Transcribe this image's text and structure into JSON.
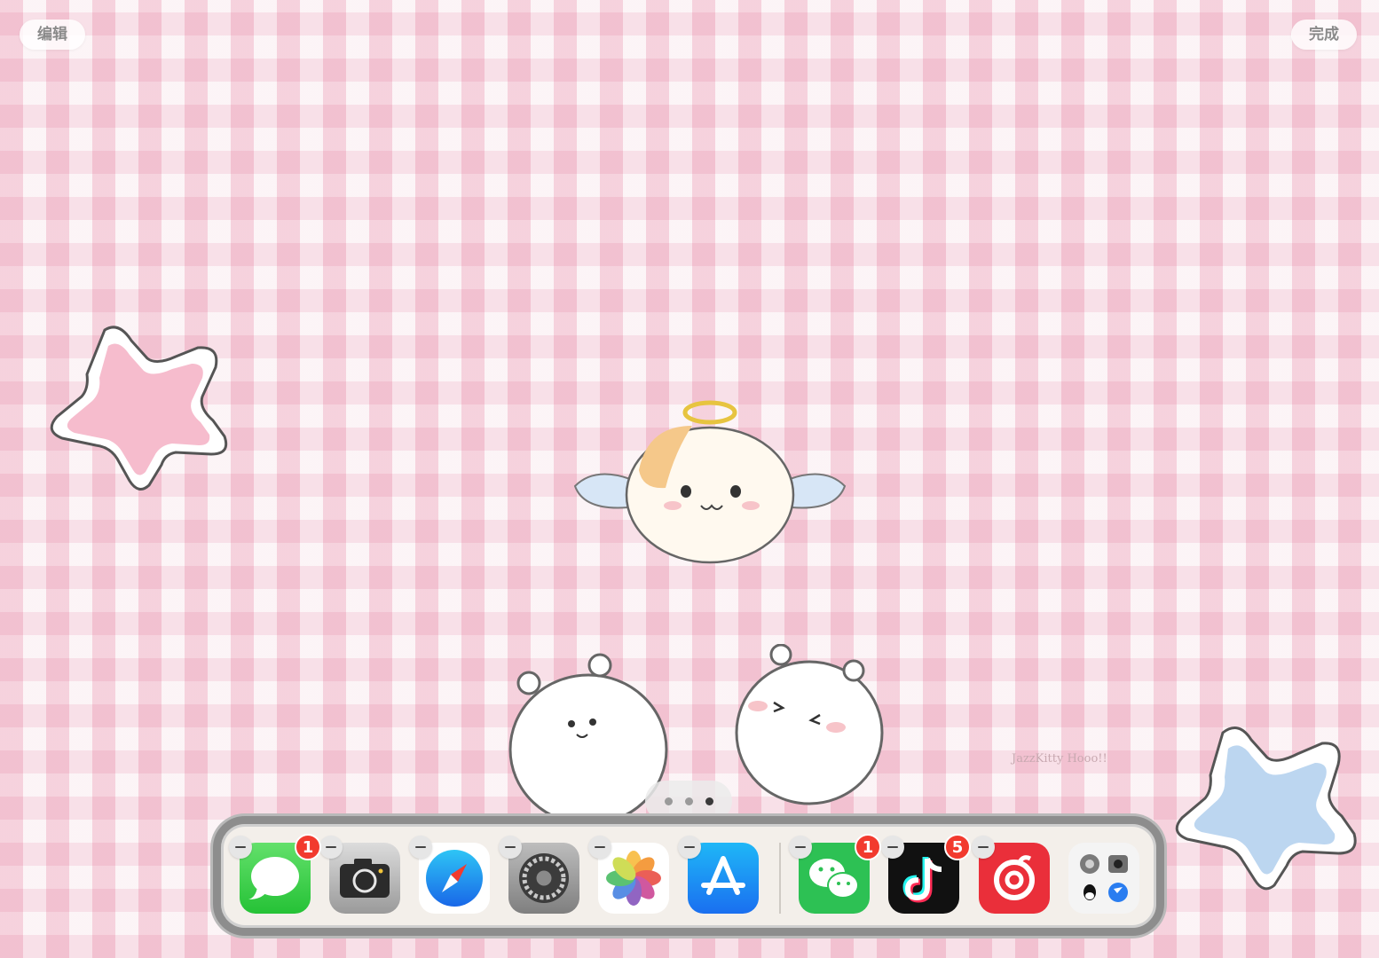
{
  "topbar": {
    "edit_label": "编辑",
    "done_label": "完成"
  },
  "wallpaper": {
    "signature_text": "JazzKitty Hooo!!"
  },
  "page_dots": {
    "count": 3,
    "active_index": 2
  },
  "dock": {
    "apps": [
      {
        "name": "Messages",
        "icon": "messages-icon",
        "badge": "1"
      },
      {
        "name": "Camera",
        "icon": "camera-icon",
        "badge": ""
      },
      {
        "name": "Safari",
        "icon": "safari-icon",
        "badge": ""
      },
      {
        "name": "Settings",
        "icon": "settings-icon",
        "badge": ""
      },
      {
        "name": "Photos",
        "icon": "photos-icon",
        "badge": ""
      },
      {
        "name": "App Store",
        "icon": "app-store-icon",
        "badge": ""
      }
    ],
    "recent_apps": [
      {
        "name": "WeChat",
        "icon": "wechat-icon",
        "badge": "1"
      },
      {
        "name": "TikTok",
        "icon": "tiktok-icon",
        "badge": "5"
      },
      {
        "name": "NetEase Music",
        "icon": "netease-music-icon",
        "badge": ""
      },
      {
        "name": "App Library",
        "icon": "app-library-icon",
        "badge": ""
      }
    ]
  }
}
